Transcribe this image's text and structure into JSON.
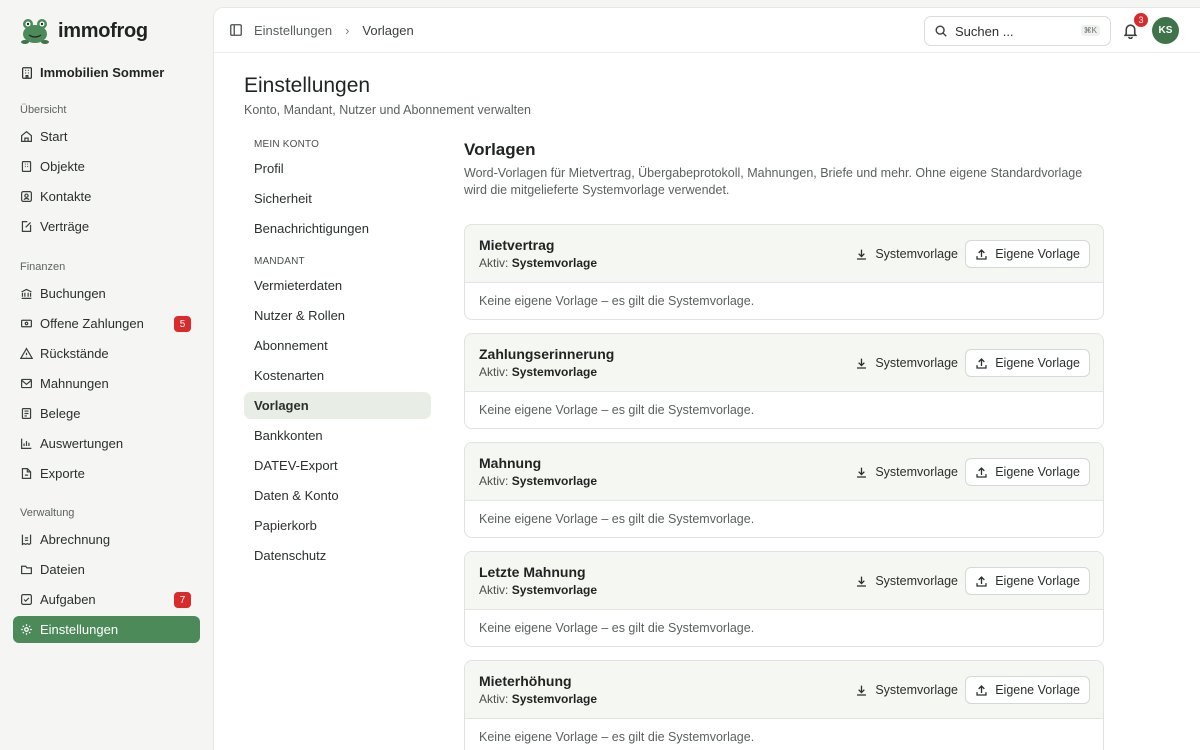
{
  "app": {
    "name": "immofrog",
    "tenant": "Immobilien Sommer"
  },
  "sidebar": {
    "sections": [
      {
        "label": "Übersicht"
      },
      {
        "label": "Finanzen"
      },
      {
        "label": "Verwaltung"
      }
    ],
    "items": [
      {
        "label": "Start",
        "icon": "home-icon"
      },
      {
        "label": "Objekte",
        "icon": "building-icon"
      },
      {
        "label": "Kontakte",
        "icon": "contact-icon"
      },
      {
        "label": "Verträge",
        "icon": "contract-icon"
      },
      {
        "label": "Buchungen",
        "icon": "bank-icon"
      },
      {
        "label": "Offene Zahlungen",
        "icon": "payment-icon",
        "badge": "5"
      },
      {
        "label": "Rückstände",
        "icon": "warning-icon"
      },
      {
        "label": "Mahnungen",
        "icon": "mail-icon"
      },
      {
        "label": "Belege",
        "icon": "receipt-icon"
      },
      {
        "label": "Auswertungen",
        "icon": "chart-icon"
      },
      {
        "label": "Exporte",
        "icon": "export-icon"
      },
      {
        "label": "Abrechnung",
        "icon": "calculator-icon"
      },
      {
        "label": "Dateien",
        "icon": "folder-icon"
      },
      {
        "label": "Aufgaben",
        "icon": "task-icon",
        "badge": "7"
      },
      {
        "label": "Einstellungen",
        "icon": "gear-icon",
        "active": true
      }
    ]
  },
  "topbar": {
    "breadcrumb": [
      "Einstellungen",
      "Vorlagen"
    ],
    "search_placeholder": "Suchen ...",
    "search_shortcut": "⌘K",
    "notifications_count": "3",
    "avatar_initials": "KS"
  },
  "page": {
    "title": "Einstellungen",
    "subtitle": "Konto, Mandant, Nutzer und Abonnement verwalten"
  },
  "settings_nav": {
    "groups": [
      {
        "label": "Mein Konto",
        "items": [
          "Profil",
          "Sicherheit",
          "Benachrichtigungen"
        ]
      },
      {
        "label": "Mandant",
        "items": [
          "Vermieterdaten",
          "Nutzer & Rollen",
          "Abonnement",
          "Kostenarten",
          "Vorlagen",
          "Bankkonten",
          "DATEV-Export",
          "Daten & Konto",
          "Papierkorb",
          "Datenschutz"
        ]
      }
    ],
    "active": "Vorlagen"
  },
  "content": {
    "title": "Vorlagen",
    "description": "Word-Vorlagen für Mietvertrag, Übergabeprotokoll, Mahnungen, Briefe und mehr. Ohne eigene Standardvorlage wird die mitgelieferte Systemvorlage verwendet.",
    "active_prefix": "Aktiv:",
    "system_button": "Systemvorlage",
    "own_button": "Eigene Vorlage",
    "templates": [
      {
        "name": "Mietvertrag",
        "active": "Systemvorlage",
        "note": "Keine eigene Vorlage – es gilt die Systemvorlage."
      },
      {
        "name": "Zahlungserinnerung",
        "active": "Systemvorlage",
        "note": "Keine eigene Vorlage – es gilt die Systemvorlage."
      },
      {
        "name": "Mahnung",
        "active": "Systemvorlage",
        "note": "Keine eigene Vorlage – es gilt die Systemvorlage."
      },
      {
        "name": "Letzte Mahnung",
        "active": "Systemvorlage",
        "note": "Keine eigene Vorlage – es gilt die Systemvorlage."
      },
      {
        "name": "Mieterhöhung",
        "active": "Systemvorlage",
        "note": "Keine eigene Vorlage – es gilt die Systemvorlage."
      }
    ]
  },
  "colors": {
    "accent": "#4d8a5a",
    "badge": "#d92b2b",
    "avatar": "#3f7349"
  }
}
